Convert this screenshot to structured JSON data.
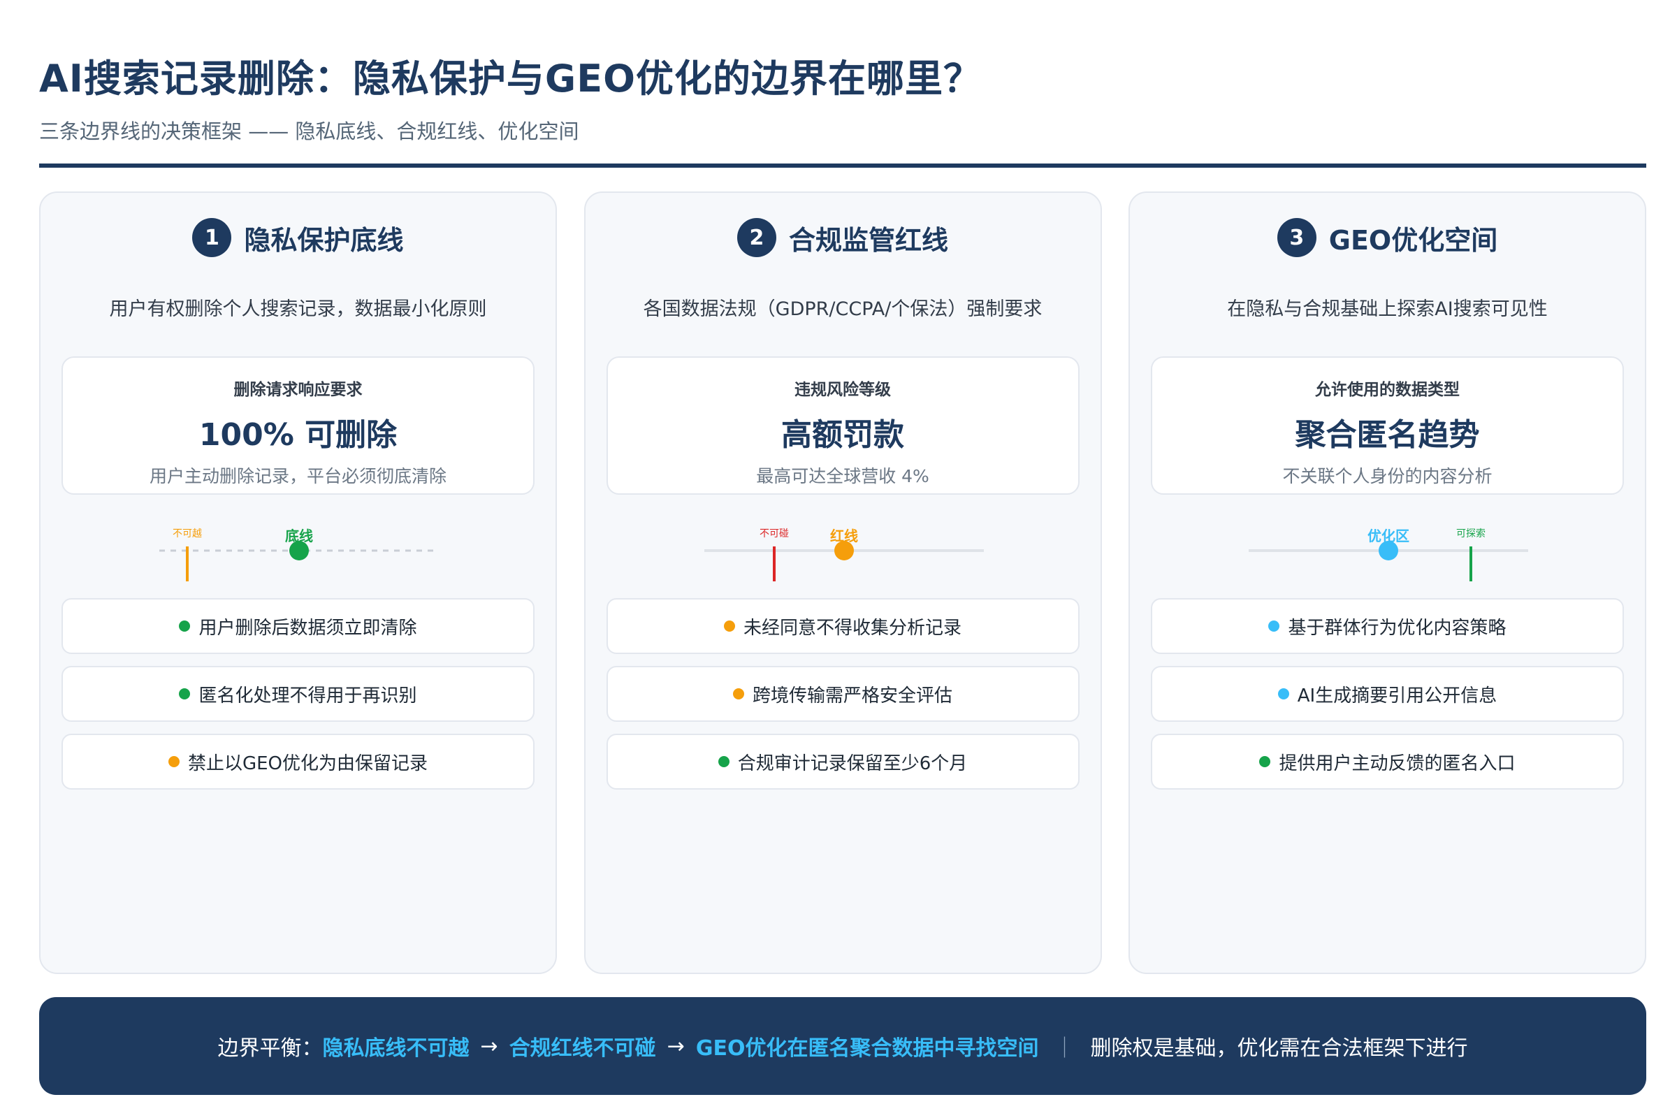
{
  "header": {
    "title": "AI搜索记录删除：隐私保护与GEO优化的边界在哪里？",
    "subtitle": "三条边界线的决策框架 —— 隐私底线、合规红线、优化空间"
  },
  "columns": [
    {
      "num": "1",
      "title": "隐私保护底线",
      "desc": "用户有权删除个人搜索记录，数据最小化原则",
      "metric": {
        "label": "删除请求响应要求",
        "value": "100% 可删除",
        "note": "用户主动删除记录，平台必须彻底清除"
      },
      "scale": {
        "tick_label": "不可越",
        "marker_label": "底线"
      },
      "rules": [
        {
          "text": "用户删除后数据须立即清除",
          "dot": "green"
        },
        {
          "text": "匿名化处理不得用于再识别",
          "dot": "green"
        },
        {
          "text": "禁止以GEO优化为由保留记录",
          "dot": "orange"
        }
      ]
    },
    {
      "num": "2",
      "title": "合规监管红线",
      "desc": "各国数据法规（GDPR/CCPA/个保法）强制要求",
      "metric": {
        "label": "违规风险等级",
        "value": "高额罚款",
        "note": "最高可达全球营收 4%"
      },
      "scale": {
        "tick_label": "不可碰",
        "marker_label": "红线"
      },
      "rules": [
        {
          "text": "未经同意不得收集分析记录",
          "dot": "orange"
        },
        {
          "text": "跨境传输需严格安全评估",
          "dot": "orange"
        },
        {
          "text": "合规审计记录保留至少6个月",
          "dot": "green"
        }
      ]
    },
    {
      "num": "3",
      "title": "GEO优化空间",
      "desc": "在隐私与合规基础上探索AI搜索可见性",
      "metric": {
        "label": "允许使用的数据类型",
        "value": "聚合匿名趋势",
        "note": "不关联个人身份的内容分析"
      },
      "scale": {
        "tick_label": "可探索",
        "marker_label": "优化区"
      },
      "rules": [
        {
          "text": "基于群体行为优化内容策略",
          "dot": "blue"
        },
        {
          "text": "AI生成摘要引用公开信息",
          "dot": "blue"
        },
        {
          "text": "提供用户主动反馈的匿名入口",
          "dot": "green"
        }
      ]
    }
  ],
  "footer": {
    "lead": "边界平衡：",
    "step1": "隐私底线不可越",
    "step2": "合规红线不可碰",
    "step3": "GEO优化在匿名聚合数据中寻找空间",
    "arrow": "→",
    "separator": "｜",
    "tail": "删除权是基础，优化需在合法框架下进行"
  },
  "colors": {
    "navy": "#1e3a5f",
    "green": "#16a34a",
    "orange": "#f59e0b",
    "red": "#dc2626",
    "blue": "#38bdf8",
    "highlight": "#38bdf8"
  }
}
